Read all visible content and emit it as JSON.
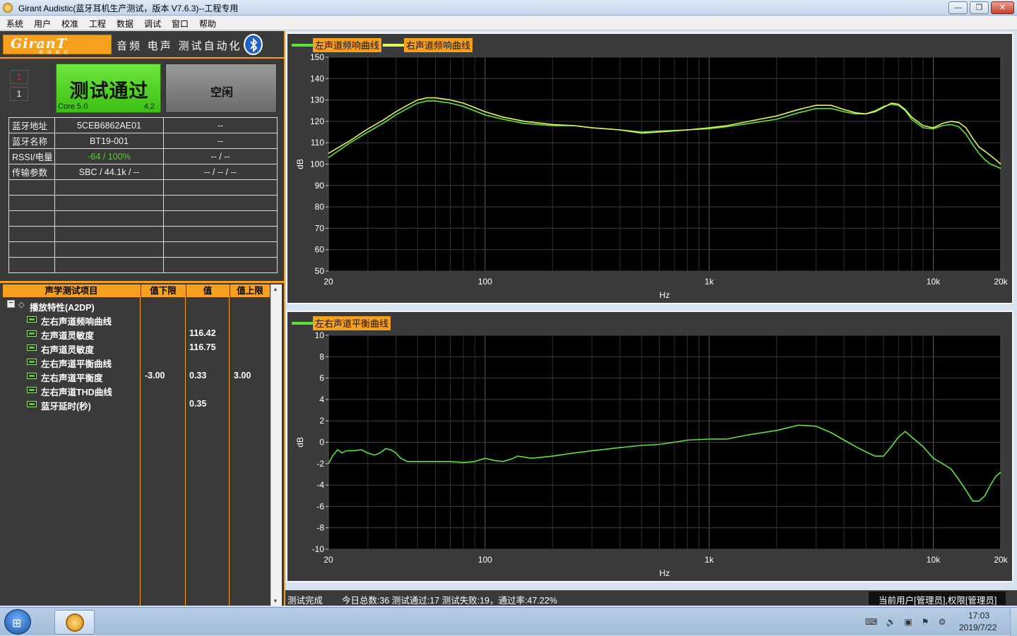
{
  "window": {
    "title": "Girant Audistic(蓝牙耳机生产测试，版本  V7.6.3)--工程专用",
    "min": "—",
    "max": "❐",
    "close": "✕"
  },
  "menu": [
    "系统",
    "用户",
    "校准",
    "工程",
    "数据",
    "调试",
    "窗口",
    "帮助"
  ],
  "brand": {
    "logo": "GiranT",
    "sub": "格 朗 测 控",
    "slogan": "音频 电声 测试自动化"
  },
  "left": {
    "index1": "1",
    "index2": "1",
    "result": "测试通过",
    "core_label": "Core 5.0",
    "core_version": "4.2",
    "idle": "空闲",
    "info": [
      {
        "k": "蓝牙地址",
        "v1": "5CEB6862AE01",
        "v2": "--"
      },
      {
        "k": "蓝牙名称",
        "v1": "BT19-001",
        "v2": "--"
      },
      {
        "k": "RSSI/电量",
        "v1": "-64 / 100%",
        "v2": "-- / --"
      },
      {
        "k": "传输参数",
        "v1": "SBC / 44.1k / --",
        "v2": "-- / -- / --"
      }
    ],
    "colors": {
      "accent": "#f7a01d",
      "pass": "#4cd81e",
      "panel": "#3a3a3a"
    }
  },
  "test_list": {
    "headers": [
      "声学测试项目",
      "值下限",
      "值",
      "值上限"
    ],
    "group": "播放特性(A2DP)",
    "expander": "−",
    "items": [
      {
        "name": "左右声道频响曲线",
        "low": "",
        "value": "",
        "high": ""
      },
      {
        "name": "左声道灵敏度",
        "low": "",
        "value": "116.42",
        "high": ""
      },
      {
        "name": "右声道灵敏度",
        "low": "",
        "value": "116.75",
        "high": ""
      },
      {
        "name": "左右声道平衡曲线",
        "low": "",
        "value": "",
        "high": ""
      },
      {
        "name": "左右声道平衡度",
        "low": "-3.00",
        "value": "0.33",
        "high": "3.00"
      },
      {
        "name": "左右声道THD曲线",
        "low": "",
        "value": "",
        "high": ""
      },
      {
        "name": "蓝牙延时(秒)",
        "low": "",
        "value": "0.35",
        "high": ""
      }
    ]
  },
  "chart_data": [
    {
      "type": "line",
      "title": "",
      "xlabel": "Hz",
      "ylabel": "dB",
      "xscale": "log",
      "xlim": [
        20,
        20000
      ],
      "ylim": [
        50,
        150
      ],
      "xticks": [
        20,
        100,
        1000,
        10000,
        20000
      ],
      "xtick_labels": [
        "20",
        "100",
        "1k",
        "10k",
        "20k"
      ],
      "yticks": [
        50,
        60,
        70,
        80,
        90,
        100,
        110,
        120,
        130,
        140,
        150
      ],
      "grid": true,
      "legend": "top-left",
      "series": [
        {
          "name": "左声道频响曲线",
          "color": "#5ee33a",
          "x": [
            20,
            25,
            30,
            35,
            40,
            45,
            50,
            55,
            60,
            70,
            80,
            100,
            120,
            150,
            200,
            250,
            300,
            400,
            500,
            600,
            800,
            1000,
            1200,
            1500,
            2000,
            2500,
            3000,
            3500,
            4000,
            4500,
            5000,
            5500,
            6000,
            6500,
            7000,
            7500,
            8000,
            9000,
            10000,
            11000,
            12000,
            13000,
            14000,
            15000,
            16000,
            17000,
            18000,
            19000,
            20000
          ],
          "y": [
            103,
            110,
            115,
            119,
            123,
            126,
            128.5,
            129.5,
            129.5,
            128.5,
            127,
            123,
            121,
            119,
            118,
            118,
            117,
            116,
            115,
            115.5,
            116,
            116.5,
            117.5,
            119,
            121,
            124,
            126,
            126,
            124.5,
            123.5,
            123.5,
            125,
            127,
            128,
            127.5,
            125,
            121,
            117,
            116.5,
            118,
            118.5,
            117.5,
            114,
            109,
            105,
            102,
            100,
            99,
            98
          ]
        },
        {
          "name": "右声道频响曲线",
          "color": "#e6f55a",
          "x": [
            20,
            25,
            30,
            35,
            40,
            45,
            50,
            55,
            60,
            70,
            80,
            100,
            120,
            150,
            200,
            250,
            300,
            400,
            500,
            600,
            800,
            1000,
            1200,
            1500,
            2000,
            2500,
            3000,
            3500,
            4000,
            4500,
            5000,
            5500,
            6000,
            6500,
            7000,
            7500,
            8000,
            9000,
            10000,
            11000,
            12000,
            13000,
            14000,
            15000,
            16000,
            17000,
            18000,
            19000,
            20000
          ],
          "y": [
            105,
            111,
            116.5,
            120.5,
            124.5,
            127.5,
            130,
            131,
            131,
            130,
            128.5,
            124.5,
            122,
            120,
            118.5,
            118,
            117,
            116,
            114.5,
            115,
            116,
            117,
            118,
            120,
            122.5,
            125.5,
            127.5,
            127.5,
            125.5,
            124,
            123.5,
            124.5,
            126.5,
            128.5,
            128,
            125.5,
            122,
            118,
            117,
            119,
            120,
            119.5,
            117,
            112,
            108,
            106,
            104,
            102,
            100
          ]
        }
      ]
    },
    {
      "type": "line",
      "title": "",
      "xlabel": "Hz",
      "ylabel": "dB",
      "xscale": "log",
      "xlim": [
        20,
        20000
      ],
      "ylim": [
        -10,
        10
      ],
      "xticks": [
        20,
        100,
        1000,
        10000,
        20000
      ],
      "xtick_labels": [
        "20",
        "100",
        "1k",
        "10k",
        "20k"
      ],
      "yticks": [
        -10,
        -8,
        -6,
        -4,
        -2,
        0,
        2,
        4,
        6,
        8,
        10
      ],
      "grid": true,
      "legend": "top-left",
      "series": [
        {
          "name": "左右声道平衡曲线",
          "color": "#5ee33a",
          "x": [
            20,
            21,
            22,
            23,
            24,
            26,
            28,
            30,
            32,
            34,
            36,
            38,
            40,
            42,
            45,
            48,
            50,
            55,
            60,
            70,
            80,
            90,
            100,
            110,
            120,
            130,
            140,
            150,
            160,
            180,
            200,
            250,
            300,
            400,
            500,
            600,
            700,
            800,
            1000,
            1200,
            1500,
            2000,
            2500,
            3000,
            3500,
            4000,
            4500,
            5000,
            5500,
            6000,
            6500,
            7000,
            7500,
            8000,
            9000,
            10000,
            11000,
            12000,
            13000,
            14000,
            15000,
            16000,
            17000,
            18000,
            19000,
            20000
          ],
          "y": [
            -2.0,
            -1.2,
            -0.7,
            -1.0,
            -0.8,
            -0.8,
            -0.7,
            -1.0,
            -1.2,
            -1.0,
            -0.6,
            -0.7,
            -1.0,
            -1.5,
            -1.8,
            -1.8,
            -1.8,
            -1.8,
            -1.8,
            -1.8,
            -1.9,
            -1.8,
            -1.5,
            -1.7,
            -1.8,
            -1.6,
            -1.3,
            -1.4,
            -1.5,
            -1.4,
            -1.3,
            -1.0,
            -0.8,
            -0.5,
            -0.3,
            -0.2,
            0.0,
            0.2,
            0.3,
            0.3,
            0.7,
            1.1,
            1.6,
            1.5,
            0.9,
            0.2,
            -0.4,
            -0.9,
            -1.3,
            -1.3,
            -0.4,
            0.5,
            1.0,
            0.5,
            -0.4,
            -1.5,
            -2.0,
            -2.5,
            -3.5,
            -4.5,
            -5.5,
            -5.5,
            -5.0,
            -4.0,
            -3.2,
            -2.8
          ]
        }
      ]
    }
  ],
  "status": {
    "left": "测试完成",
    "summary": "今日总数:36 测试通过:17 测试失败:19，通过率:47.22%",
    "user": "当前用户[管理员],权限[管理员]"
  },
  "taskbar": {
    "time": "17:03",
    "date": "2019/7/22",
    "start_glyph": "⊞",
    "tray": [
      "⌨",
      "🔊",
      "▣",
      "⚑",
      "⚙"
    ]
  }
}
